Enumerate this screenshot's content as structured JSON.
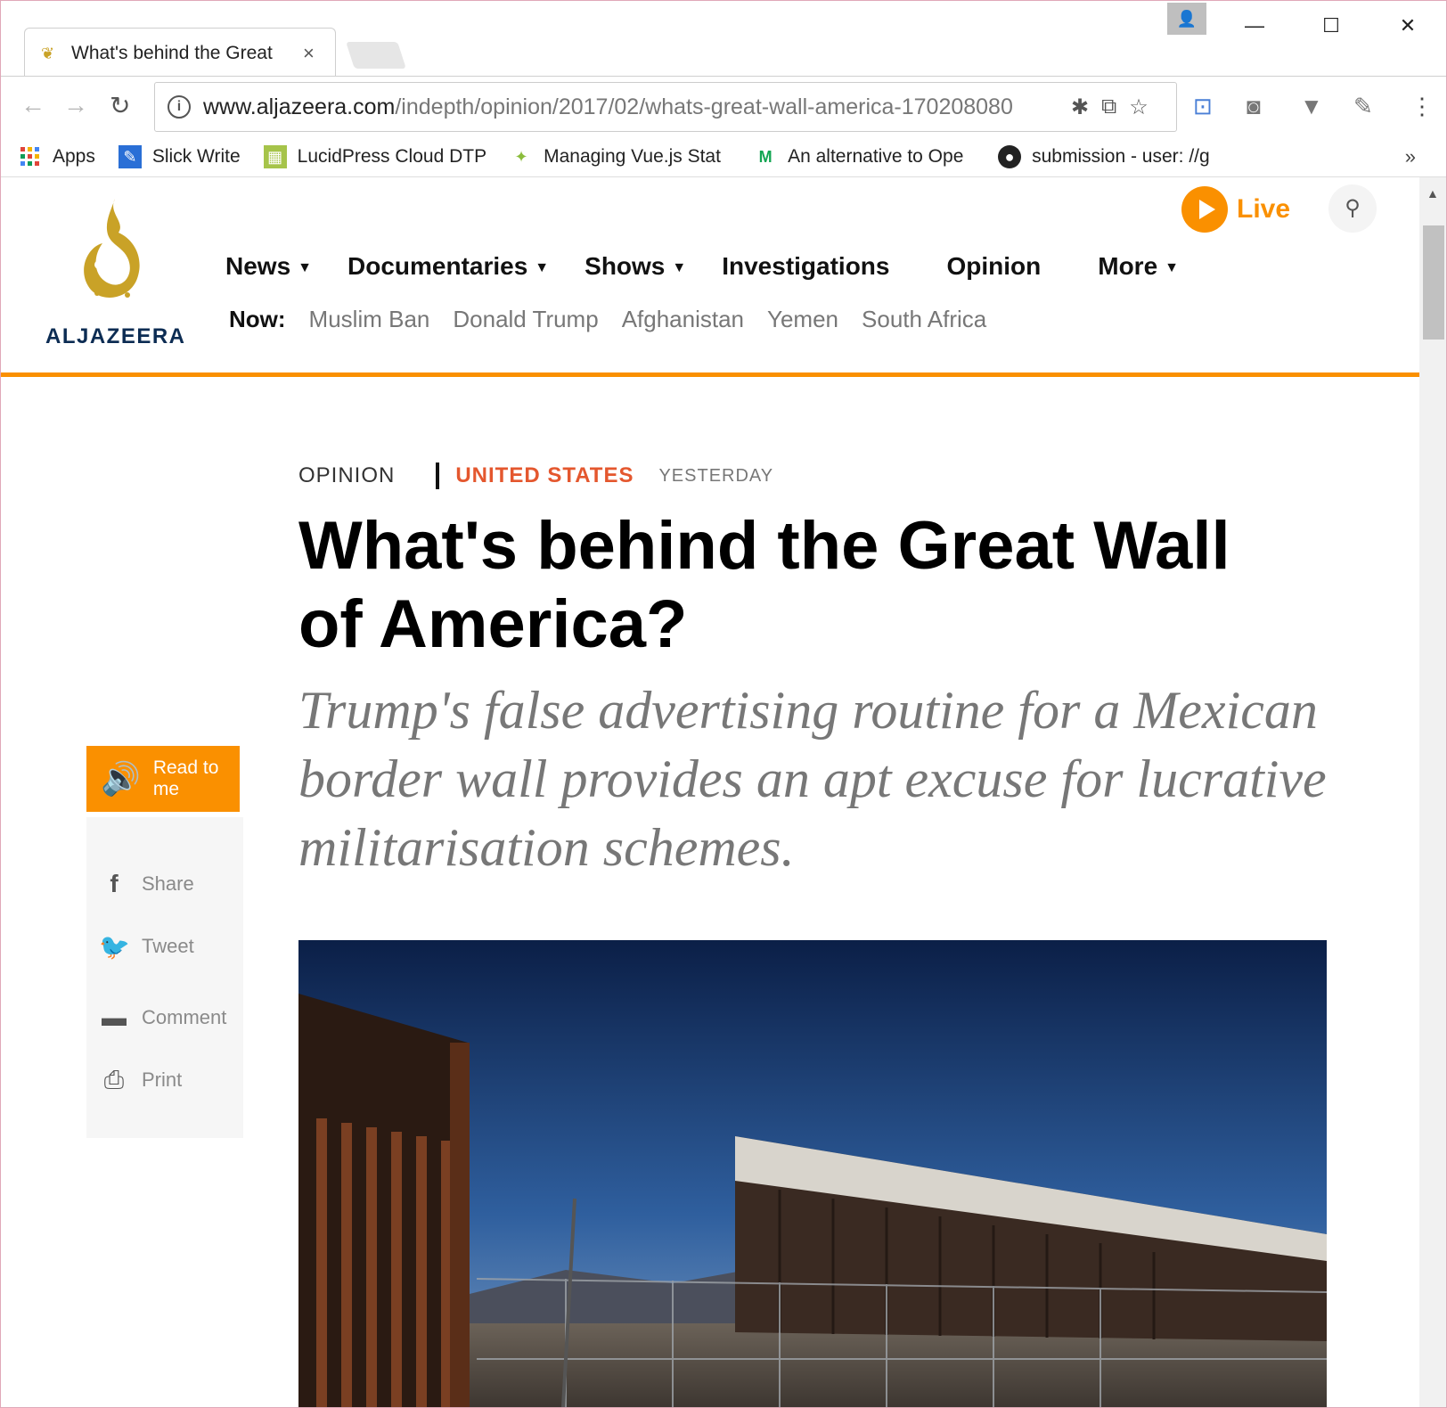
{
  "browser": {
    "tab_title": "What's behind the Great",
    "tab_close": "×",
    "url_host": "www.aljazeera.com",
    "url_path": "/indepth/opinion/2017/02/whats-great-wall-america-170208080",
    "bookmarks": [
      {
        "label": "Apps",
        "icon": "apps-grid-icon"
      },
      {
        "label": "Slick Write",
        "icon": "slick-write-icon"
      },
      {
        "label": "LucidPress Cloud DTP",
        "icon": "lucidpress-icon"
      },
      {
        "label": "Managing Vue.js Stat",
        "icon": "vue-icon"
      },
      {
        "label": "An alternative to Ope",
        "icon": "medium-icon"
      },
      {
        "label": "submission - user: //g",
        "icon": "github-icon"
      }
    ],
    "bookmarks_more": "»"
  },
  "site": {
    "wordmark": "ALJAZEERA",
    "nav": [
      "News",
      "Documentaries",
      "Shows",
      "Investigations",
      "Opinion",
      "More"
    ],
    "now_label": "Now:",
    "now_items": [
      "Muslim Ban",
      "Donald Trump",
      "Afghanistan",
      "Yemen",
      "South Africa"
    ],
    "live_label": "Live",
    "accent": "#fa9000"
  },
  "article": {
    "section": "OPINION",
    "topic": "UNITED STATES",
    "date": "YESTERDAY",
    "headline": "What's behind the Great Wall of America?",
    "standfirst": "Trump's false advertising routine for a Mexican border wall provides an apt excuse for lucrative militarisation schemes.",
    "read_to_me": "Read to me",
    "share": [
      {
        "label": "Share",
        "icon": "facebook-icon"
      },
      {
        "label": "Tweet",
        "icon": "twitter-icon"
      },
      {
        "label": "Comment",
        "icon": "comment-icon"
      },
      {
        "label": "Print",
        "icon": "print-icon"
      }
    ]
  }
}
